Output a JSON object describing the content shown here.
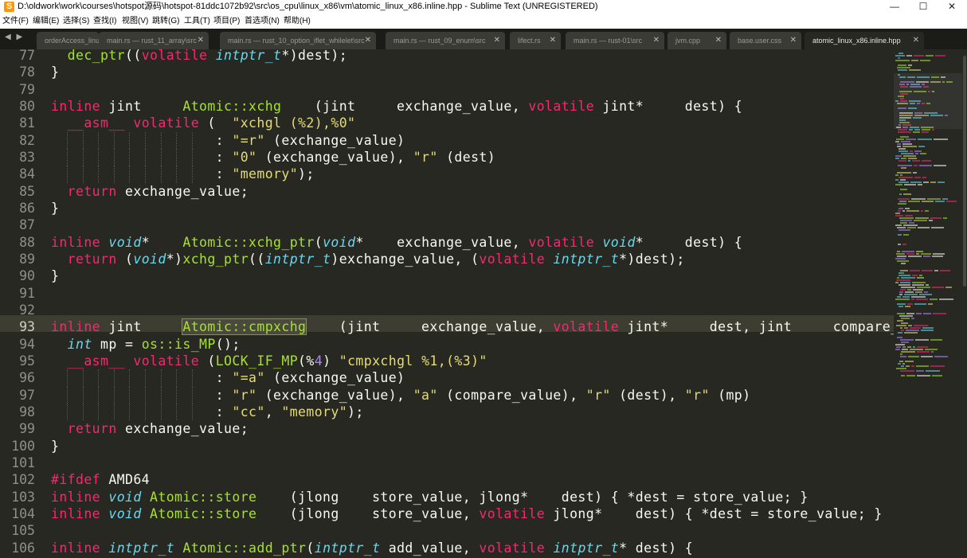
{
  "window": {
    "title": "D:\\oldwork\\work\\courses\\hotspot源码\\hotspot-81ddc1072b92\\src\\os_cpu\\linux_x86\\vm\\atomic_linux_x86.inline.hpp - Sublime Text (UNREGISTERED)",
    "minimize": "—",
    "maximize": "☐",
    "close": "✕"
  },
  "menu": [
    "文件(F)",
    "编辑(E)",
    "选择(S)",
    "查找(I)",
    "视图(V)",
    "跳转(G)",
    "工具(T)",
    "项目(P)",
    "首选项(N)",
    "帮助(H)"
  ],
  "tabs": [
    {
      "label": "orderAccess_linux",
      "close": ""
    },
    {
      "label": "main.rs — rust_11_array\\src",
      "close": "✕"
    },
    {
      "label": "main.rs — rust_10_option_iflet_whilelet\\src",
      "close": "✕"
    },
    {
      "label": "main.rs — rust_09_enum\\src",
      "close": "✕"
    },
    {
      "label": "lifect.rs",
      "close": "✕"
    },
    {
      "label": "main.rs — rust-01\\src",
      "close": "✕"
    },
    {
      "label": "jvm.cpp",
      "close": "✕"
    },
    {
      "label": "base.user.css",
      "close": "✕"
    },
    {
      "label": "atomic_linux_x86.inline.hpp",
      "close": "✕"
    }
  ],
  "nav_arrows": "◀ ▶",
  "line_numbers": [
    "77",
    "78",
    "79",
    "80",
    "81",
    "82",
    "83",
    "84",
    "85",
    "86",
    "87",
    "88",
    "89",
    "90",
    "91",
    "92",
    "93",
    "94",
    "95",
    "96",
    "97",
    "98",
    "99",
    "100",
    "101",
    "102",
    "103",
    "104",
    "105",
    "106"
  ],
  "current_line": "93",
  "code_lines": [
    "  dec_ptr((volatile intptr_t*)dest);",
    "}",
    "",
    "inline jint     Atomic::xchg    (jint     exchange_value, volatile jint*     dest) {",
    "  __asm__ volatile (  \"xchgl (%2),%0\"",
    "                    : \"=r\" (exchange_value)",
    "                    : \"0\" (exchange_value), \"r\" (dest)",
    "                    : \"memory\");",
    "  return exchange_value;",
    "}",
    "",
    "inline void*    Atomic::xchg_ptr(void*    exchange_value, volatile void*     dest) {",
    "  return (void*)xchg_ptr((intptr_t)exchange_value, (volatile intptr_t*)dest);",
    "}",
    "",
    "",
    "inline jint     Atomic::cmpxchg    (jint     exchange_value, volatile jint*     dest, jint     compare_val",
    "  int mp = os::is_MP();",
    "  __asm__ volatile (LOCK_IF_MP(%4) \"cmpxchgl %1,(%3)\"",
    "                    : \"=a\" (exchange_value)",
    "                    : \"r\" (exchange_value), \"a\" (compare_value), \"r\" (dest), \"r\" (mp)",
    "                    : \"cc\", \"memory\");",
    "  return exchange_value;",
    "}",
    "",
    "#ifdef AMD64",
    "inline void Atomic::store    (jlong    store_value, jlong*    dest) { *dest = store_value; }",
    "inline void Atomic::store    (jlong    store_value, volatile jlong*    dest) { *dest = store_value; }",
    "",
    "inline intptr_t Atomic::add_ptr(intptr_t add_value, volatile intptr_t* dest) {"
  ],
  "colors": {
    "background": "#272822",
    "keyword": "#f92672",
    "type": "#66d9ef",
    "function": "#a6e22e",
    "string": "#e6db74",
    "number": "#ae81ff",
    "text": "#f8f8f2",
    "line_number": "#90908a"
  }
}
